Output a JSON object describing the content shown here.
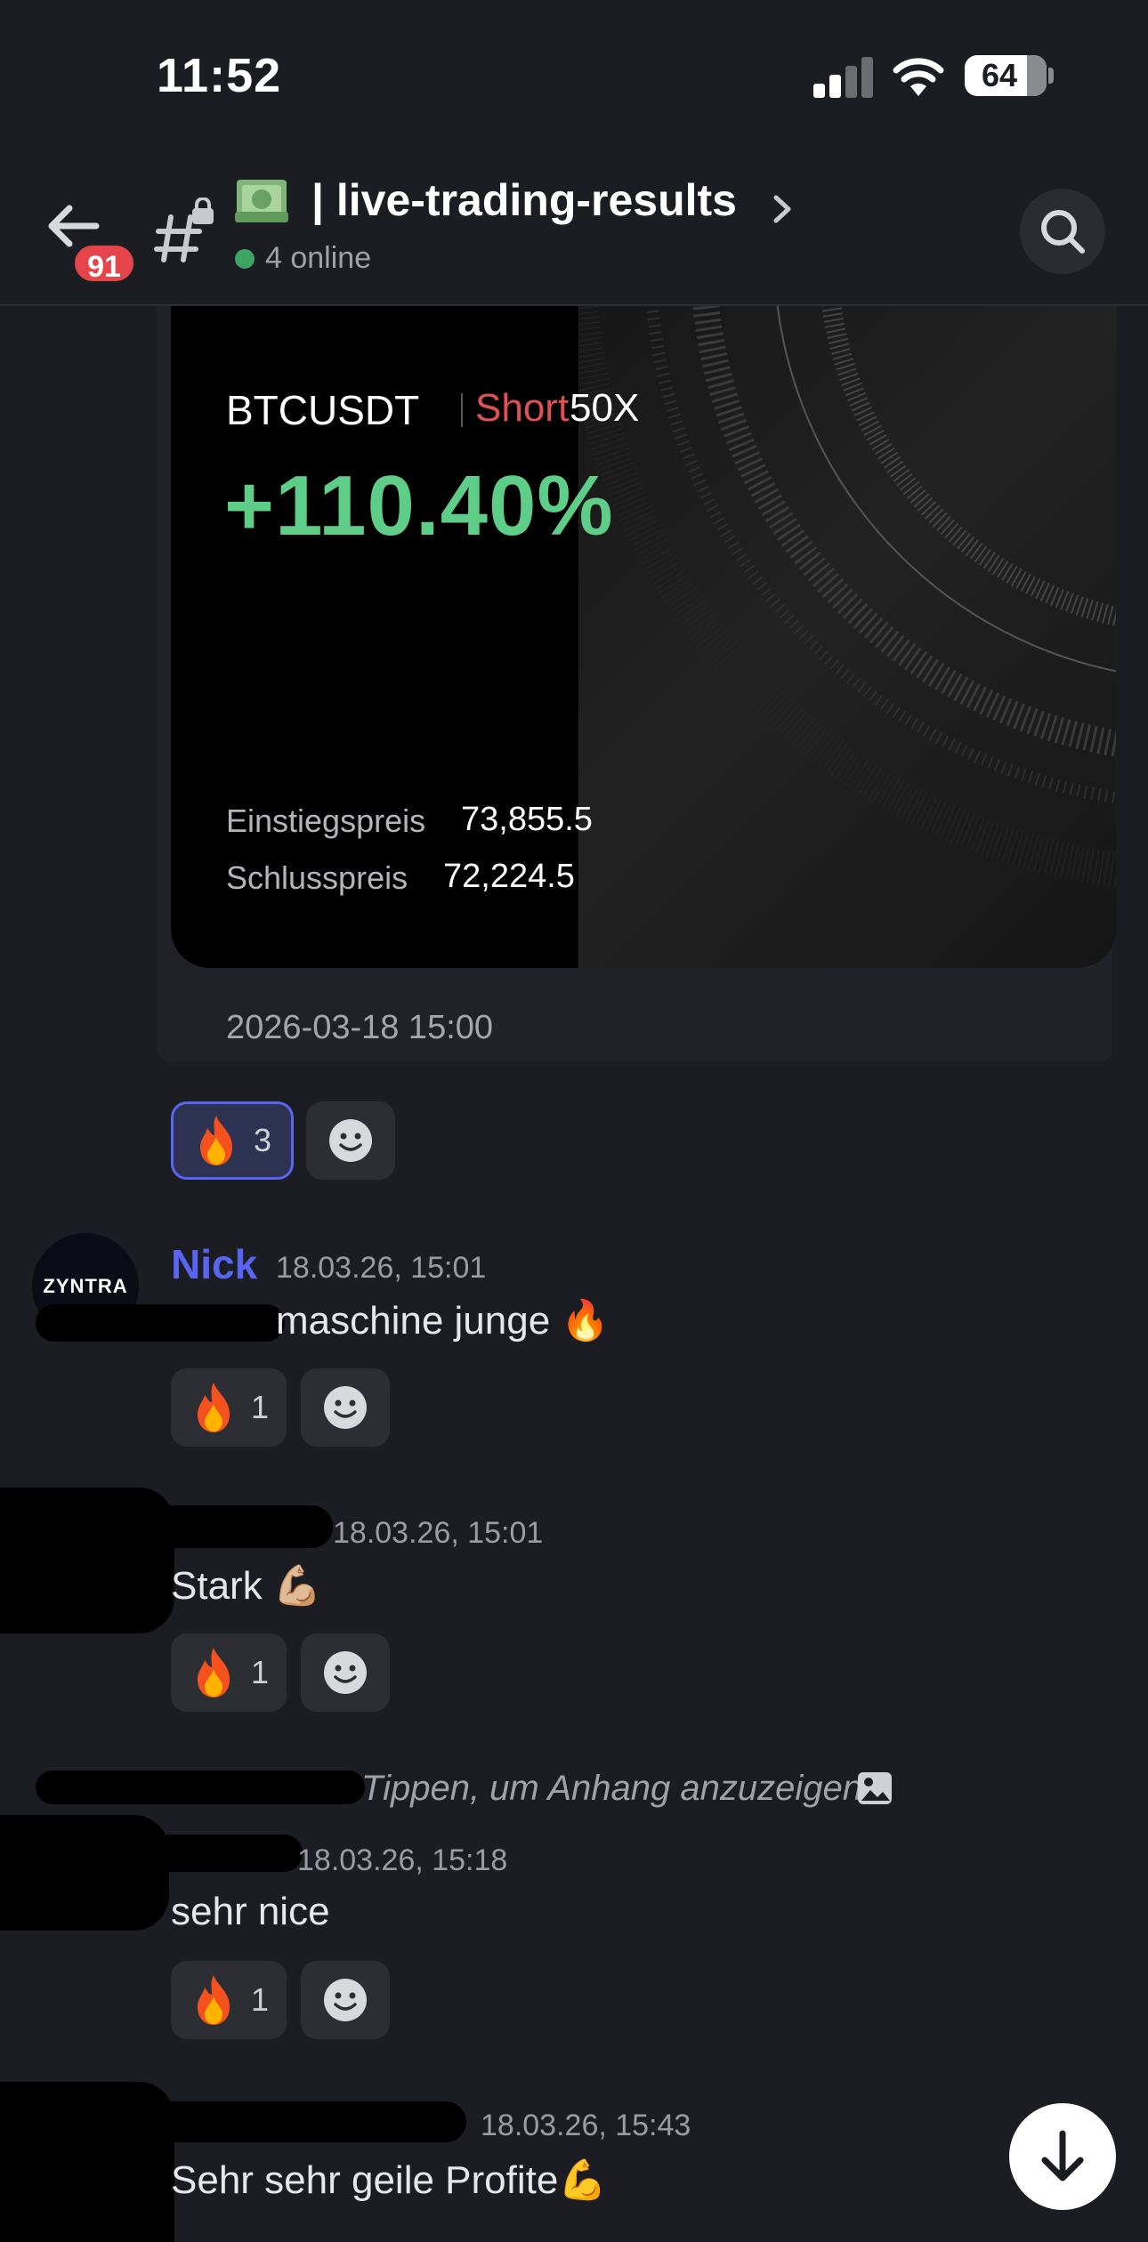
{
  "status_bar": {
    "time": "11:52",
    "battery": "64"
  },
  "header": {
    "unread_badge": "91",
    "channel_name": "| live-trading-results",
    "online_text": "4 online"
  },
  "trade_card": {
    "symbol": "BTCUSDT",
    "side": "Short",
    "leverage": "50X",
    "pnl": "+110.40%",
    "entry_label": "Einstiegspreis",
    "entry_value": "73,855.5",
    "close_label": "Schlusspreis",
    "close_value": "72,224.5",
    "timestamp": "2026-03-18 15:00",
    "reaction_count": "3"
  },
  "messages": [
    {
      "author": "Nick",
      "avatar_text": "ZYNTRA",
      "timestamp": "18.03.26, 15:01",
      "text": "maschine junge 🔥",
      "reaction_count": "1"
    },
    {
      "author": "",
      "timestamp": "18.03.26, 15:01",
      "text": "Stark 💪🏼",
      "reaction_count": "1"
    },
    {
      "author": "",
      "reply_hint": "Tippen, um Anhang anzuzeigen",
      "timestamp": "18.03.26, 15:18",
      "text": "sehr nice",
      "reaction_count": "1"
    },
    {
      "author": "",
      "timestamp": "18.03.26, 15:43",
      "text": "Sehr sehr geile Profite💪"
    }
  ],
  "colors": {
    "background": "#1c1d22",
    "accent": "#5865f2",
    "profit_green": "#5ecd87",
    "short_red": "#e05153",
    "badge_red": "#e5454a",
    "online_green": "#3ea463"
  },
  "icons": [
    "back-arrow-icon",
    "channel-hash-lock-icon",
    "money-emoji-icon",
    "chevron-right-icon",
    "search-icon",
    "fire-icon",
    "add-reaction-icon",
    "image-icon",
    "arrow-down-icon"
  ]
}
